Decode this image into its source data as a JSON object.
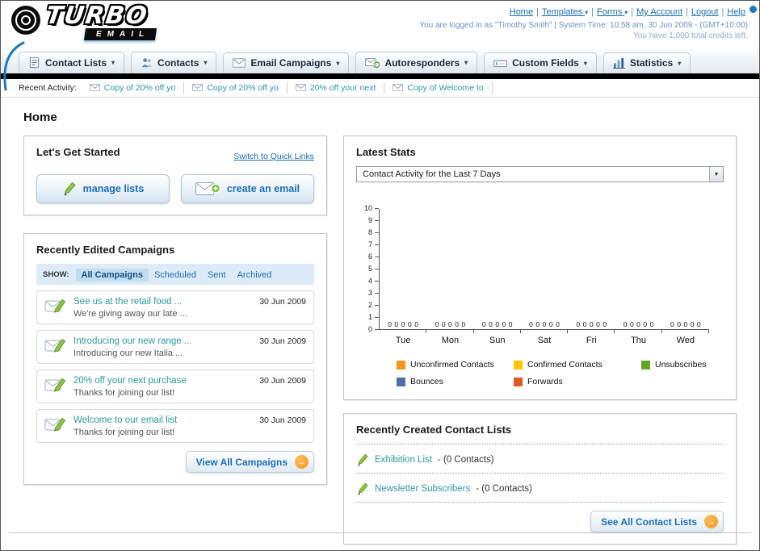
{
  "colors": {
    "accent_blue": "#1a79c0",
    "link_blue": "#1a6fb0",
    "teal_link": "#2b9a9a",
    "button_blue": "#1d6fb5",
    "orange_accent": "#f7941d",
    "nav_bar_black": "#000000"
  },
  "header": {
    "logo_title": "TURBO",
    "logo_subtitle": "EMAIL",
    "links": [
      {
        "label": "Home",
        "dropdown": false
      },
      {
        "label": "Templates",
        "dropdown": true
      },
      {
        "label": "Forms",
        "dropdown": true
      },
      {
        "label": "My Account",
        "dropdown": false
      },
      {
        "label": "Logout",
        "dropdown": false
      },
      {
        "label": "Help",
        "dropdown": false
      }
    ],
    "login_info": "You are logged in as \"Timothy Smith\" | System Time: 10:58 am, 30 Jun 2009 - (GMT+10:00)",
    "credits_info": "You have 1,000 total credits left."
  },
  "nav": {
    "tabs": [
      {
        "label": "Contact Lists",
        "icon": "contact-lists-icon"
      },
      {
        "label": "Contacts",
        "icon": "contacts-icon"
      },
      {
        "label": "Email Campaigns",
        "icon": "email-campaigns-icon"
      },
      {
        "label": "Autoresponders",
        "icon": "autoresponders-icon"
      },
      {
        "label": "Custom Fields",
        "icon": "custom-fields-icon"
      },
      {
        "label": "Statistics",
        "icon": "statistics-icon"
      }
    ]
  },
  "recent_activity": {
    "label": "Recent Activity:",
    "items": [
      "Copy of 20% off yo",
      "Copy of 20% off yo",
      "20% off your next",
      "Copy of Welcome to"
    ]
  },
  "page_title": "Home",
  "get_started": {
    "title": "Let's Get Started",
    "switch_link": "Switch to Quick Links",
    "manage_lists_label": "manage lists",
    "create_email_label": "create an email"
  },
  "campaigns": {
    "title": "Recently Edited Campaigns",
    "show_label": "SHOW:",
    "filters": [
      "All Campaigns",
      "Scheduled",
      "Sent",
      "Archived"
    ],
    "active_filter": "All Campaigns",
    "items": [
      {
        "title": "See us at the retail food ...",
        "subtitle": "We're giving away our late ...",
        "date": "30 Jun 2009"
      },
      {
        "title": "Introducing our new range ...",
        "subtitle": "Introducing our new Italia ...",
        "date": "30 Jun 2009"
      },
      {
        "title": "20% off your next purchase",
        "subtitle": "Thanks for joining our list!",
        "date": "30 Jun 2009"
      },
      {
        "title": "Welcome to our email list",
        "subtitle": "Thanks for joining our list!",
        "date": "30 Jun 2009"
      }
    ],
    "view_all_label": "View All Campaigns"
  },
  "stats": {
    "title": "Latest Stats",
    "period_selected": "Contact Activity for the Last 7 Days"
  },
  "chart_data": {
    "type": "bar",
    "title": "Contact Activity for the Last 7 Days",
    "categories": [
      "Tue",
      "Mon",
      "Sun",
      "Sat",
      "Fri",
      "Thu",
      "Wed"
    ],
    "series": [
      {
        "name": "Unconfirmed Contacts",
        "color": "#f7941d",
        "values": [
          0,
          0,
          0,
          0,
          0,
          0,
          0
        ]
      },
      {
        "name": "Confirmed Contacts",
        "color": "#fdc500",
        "values": [
          0,
          0,
          0,
          0,
          0,
          0,
          0
        ]
      },
      {
        "name": "Unsubscribes",
        "color": "#64a522",
        "values": [
          0,
          0,
          0,
          0,
          0,
          0,
          0
        ]
      },
      {
        "name": "Bounces",
        "color": "#4f6fa8",
        "values": [
          0,
          0,
          0,
          0,
          0,
          0,
          0
        ]
      },
      {
        "name": "Forwards",
        "color": "#e25822",
        "values": [
          0,
          0,
          0,
          0,
          0,
          0,
          0
        ]
      }
    ],
    "ylim": [
      0,
      10
    ],
    "yticks": [
      0,
      1,
      2,
      3,
      4,
      5,
      6,
      7,
      8,
      9,
      10
    ],
    "grid": false,
    "legend_position": "bottom",
    "bar_value_labels_shown": true
  },
  "contact_lists": {
    "title": "Recently Created Contact Lists",
    "items": [
      {
        "name": "Exhibition List",
        "meta": "- (0 Contacts)"
      },
      {
        "name": "Newsletter Subscribers",
        "meta": "- (0 Contacts)"
      }
    ],
    "see_all_label": "See All Contact Lists"
  }
}
